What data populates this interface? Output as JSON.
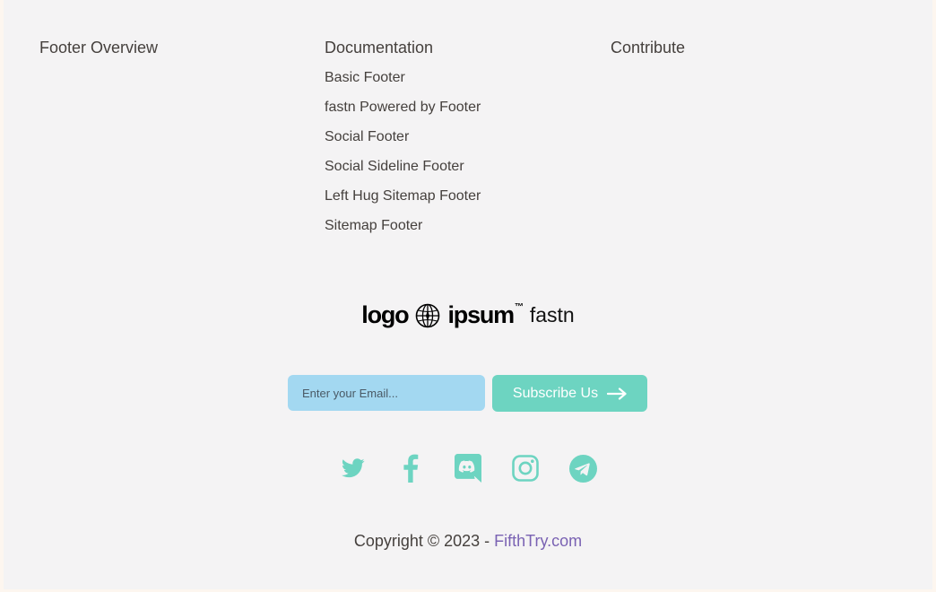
{
  "columns": [
    {
      "heading": "Footer Overview",
      "links": []
    },
    {
      "heading": "Documentation",
      "links": [
        "Basic Footer",
        "fastn Powered by Footer",
        "Social Footer",
        "Social Sideline Footer",
        "Left Hug Sitemap Footer",
        "Sitemap Footer"
      ]
    },
    {
      "heading": "Contribute",
      "links": []
    }
  ],
  "logo": {
    "word1": "logo",
    "word2": "ipsum",
    "tm": "™",
    "brand": "fastn"
  },
  "subscribe": {
    "placeholder": "Enter your Email...",
    "button_label": "Subscribe Us"
  },
  "social_icons": [
    "twitter-icon",
    "facebook-icon",
    "discord-icon",
    "instagram-icon",
    "telegram-icon"
  ],
  "copyright": {
    "prefix": "Copyright © 2023 - ",
    "link_text": "FifthTry.com"
  },
  "colors": {
    "background": "#f4f3f4",
    "text": "#45403d",
    "accent": "#6dd4c1",
    "input_bg": "#a3d8f1",
    "link": "#7a62b3"
  }
}
